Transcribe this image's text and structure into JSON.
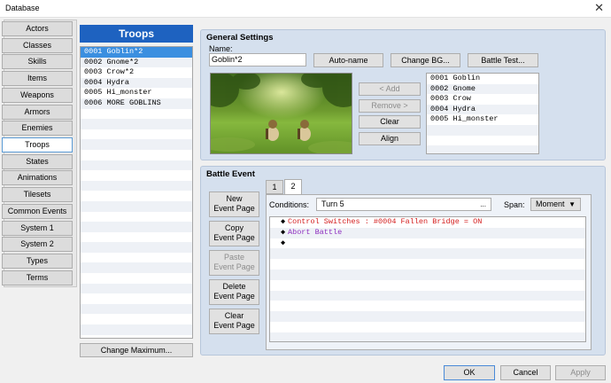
{
  "window": {
    "title": "Database",
    "close_glyph": "✕"
  },
  "categories": [
    "Actors",
    "Classes",
    "Skills",
    "Items",
    "Weapons",
    "Armors",
    "Enemies",
    "Troops",
    "States",
    "Animations",
    "Tilesets",
    "Common Events",
    "System 1",
    "System 2",
    "Types",
    "Terms"
  ],
  "active_category": "Troops",
  "troops": {
    "header": "Troops",
    "items": [
      "0001 Goblin*2",
      "0002 Gnome*2",
      "0003 Crow*2",
      "0004 Hydra",
      "0005 Hi_monster",
      "0006 MORE GOBLINS"
    ],
    "selected_index": 0,
    "change_max_label": "Change Maximum..."
  },
  "general": {
    "title": "General Settings",
    "name_label": "Name:",
    "name_value": "Goblin*2",
    "autoname_label": "Auto-name",
    "changebg_label": "Change BG...",
    "battletest_label": "Battle Test...",
    "add_label": "< Add",
    "remove_label": "Remove >",
    "clear_label": "Clear",
    "align_label": "Align",
    "enemies": [
      "0001 Goblin",
      "0002 Gnome",
      "0003 Crow",
      "0004 Hydra",
      "0005 Hi_monster"
    ]
  },
  "battle_event": {
    "title": "Battle Event",
    "tabs": [
      "1",
      "2"
    ],
    "active_tab": "2",
    "conditions_label": "Conditions:",
    "conditions_value": "Turn 5",
    "conditions_ellipsis": "...",
    "span_label": "Span:",
    "span_value": "Moment",
    "commands": [
      {
        "text": "Control Switches : #0004 Fallen Bridge = ON",
        "color": "#d42020"
      },
      {
        "text": "Abort Battle",
        "color": "#8e2fbf"
      },
      {
        "text": "",
        "color": "#000000"
      }
    ],
    "page_buttons": {
      "new_line1": "New",
      "new_line2": "Event Page",
      "copy_line1": "Copy",
      "copy_line2": "Event Page",
      "paste_line1": "Paste",
      "paste_line2": "Event Page",
      "delete_line1": "Delete",
      "delete_line2": "Event Page",
      "clear_line1": "Clear",
      "clear_line2": "Event Page"
    }
  },
  "footer": {
    "ok_label": "OK",
    "cancel_label": "Cancel",
    "apply_label": "Apply"
  },
  "colors": {
    "accent": "#1e62c0",
    "selection": "#3b8fe0",
    "panel": "#d5e0ee"
  }
}
